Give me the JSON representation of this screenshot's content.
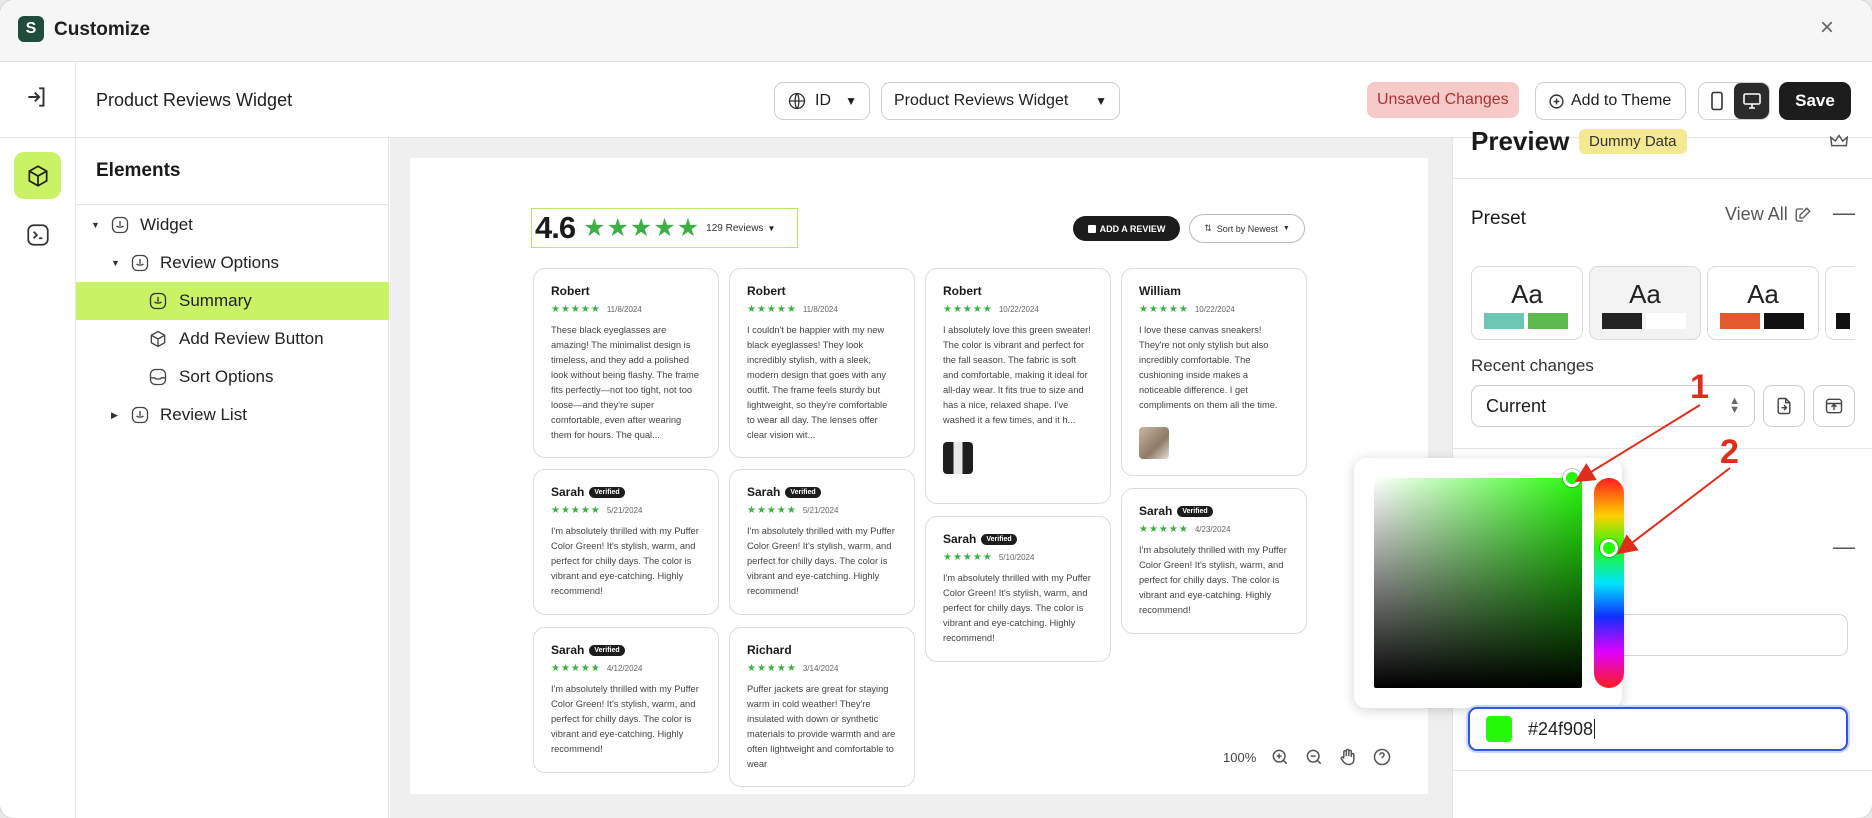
{
  "app": {
    "title": "Customize",
    "close": "×"
  },
  "toolbar": {
    "page_name": "Product Reviews Widget",
    "language": "ID",
    "widget_select": "Product Reviews Widget",
    "unsaved": "Unsaved Changes",
    "add_to_theme": "Add to Theme",
    "save": "Save"
  },
  "elements": {
    "title": "Elements",
    "tree": [
      {
        "label": "Widget"
      },
      {
        "label": "Review Options"
      },
      {
        "label": "Summary"
      },
      {
        "label": "Add Review Button"
      },
      {
        "label": "Sort Options"
      },
      {
        "label": "Review List"
      }
    ]
  },
  "preview": {
    "rating": "4.6",
    "stars": "★★★★★",
    "reviews_count": "129 Reviews",
    "add_review": "ADD A REVIEW",
    "sort_by": "Sort by Newest",
    "verified": "Verified",
    "cards": [
      {
        "name": "Robert",
        "date": "11/8/2024",
        "text": "These black eyeglasses are amazing! The minimalist design is timeless, and they add a polished look without being flashy. The frame fits perfectly—not too tight, not too loose—and they're super comfortable, even after wearing them for hours. The qual..."
      },
      {
        "name": "Robert",
        "date": "11/8/2024",
        "text": "I couldn't be happier with my new black eyeglasses! They look incredibly stylish, with a sleek, modern design that goes with any outfit. The frame feels sturdy but lightweight, so they're comfortable to wear all day. The lenses offer clear vision wit..."
      },
      {
        "name": "Robert",
        "date": "10/22/2024",
        "text": "I absolutely love this green sweater! The color is vibrant and perfect for the fall season. The fabric is soft and comfortable, making it ideal for all-day wear. It fits true to size and has a nice, relaxed shape. I've washed it a few times, and it h..."
      },
      {
        "name": "William",
        "date": "10/22/2024",
        "text": "I love these canvas sneakers! They're not only stylish but also incredibly comfortable. The cushioning inside makes a noticeable difference. I get compliments on them all the time."
      },
      {
        "name": "Sarah",
        "date": "5/21/2024",
        "text": "I'm absolutely thrilled with my Puffer Color Green! It's stylish, warm, and perfect for chilly days. The color is vibrant and eye-catching. Highly recommend!"
      },
      {
        "name": "Sarah",
        "date": "5/21/2024",
        "text": "I'm absolutely thrilled with my Puffer Color Green! It's stylish, warm, and perfect for chilly days. The color is vibrant and eye-catching. Highly recommend!"
      },
      {
        "name": "Sarah",
        "date": "5/10/2024",
        "text": "I'm absolutely thrilled with my Puffer Color Green! It's stylish, warm, and perfect for chilly days. The color is vibrant and eye-catching. Highly recommend!"
      },
      {
        "name": "Sarah",
        "date": "4/23/2024",
        "text": "I'm absolutely thrilled with my Puffer Color Green! It's stylish, warm, and perfect for chilly days. The color is vibrant and eye-catching. Highly recommend!"
      },
      {
        "name": "Sarah",
        "date": "4/12/2024",
        "text": "I'm absolutely thrilled with my Puffer Color Green! It's stylish, warm, and perfect for chilly days. The color is vibrant and eye-catching. Highly recommend!"
      },
      {
        "name": "Richard",
        "date": "3/14/2024",
        "text": "Puffer jackets are great for staying warm in cold weather! They're insulated with down or synthetic materials to provide warmth and are often lightweight and comfortable to wear"
      }
    ],
    "zoom": "100%"
  },
  "panel": {
    "title": "Preview",
    "dummy": "Dummy Data",
    "preset": "Preset",
    "view_all": "View All",
    "preset_aa": "Aa",
    "recent_changes": "Recent changes",
    "current": "Current",
    "hex": "#24f908"
  },
  "annotations": {
    "one": "1",
    "two": "2"
  },
  "colors": {
    "accent": "#c9f264",
    "star": "#3cb043",
    "picked": "#24f908",
    "focus": "#2f55e8"
  }
}
